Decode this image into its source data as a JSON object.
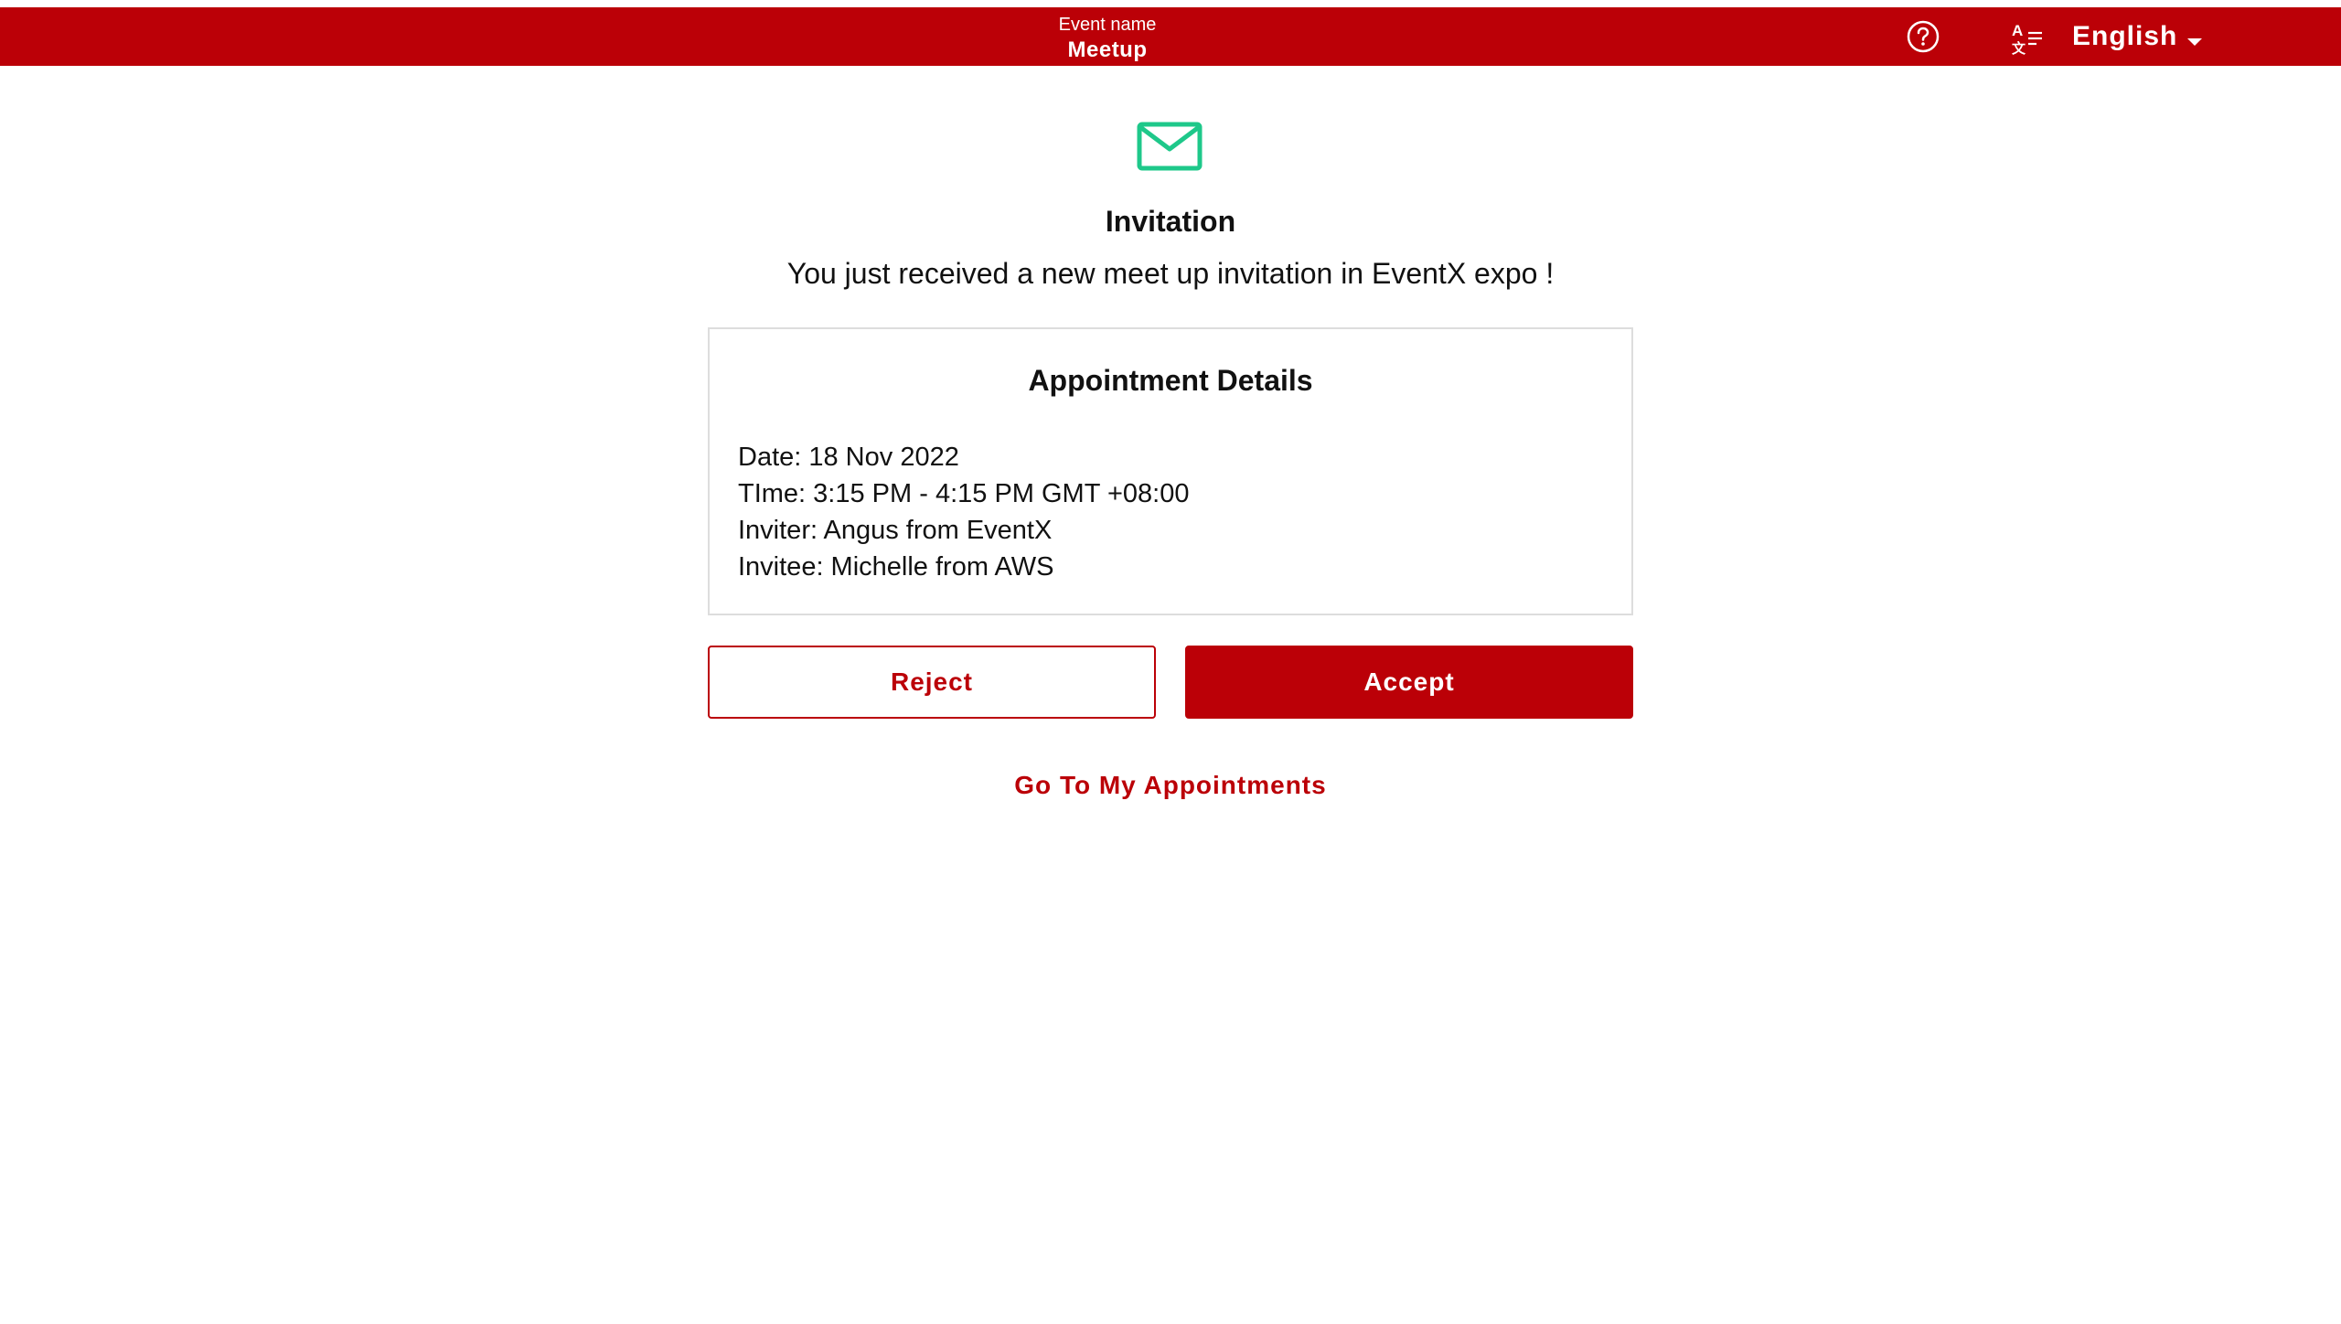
{
  "header": {
    "event_caption": "Event name",
    "event_name": "Meetup",
    "help_icon": "question-circle-icon",
    "language_icon": "translate-icon",
    "language": "English",
    "language_caret_icon": "caret-down-icon"
  },
  "invitation": {
    "icon": "envelope-icon",
    "title": "Invitation",
    "message": "You just received a new meet up invitation in EventX expo !"
  },
  "appointment": {
    "title": "Appointment Details",
    "date": "Date: 18 Nov 2022",
    "time": "TIme: 3:15 PM - 4:15 PM GMT +08:00",
    "inviter": "Inviter: Angus from EventX",
    "invitee": "Invitee: Michelle from AWS"
  },
  "actions": {
    "reject_label": "Reject",
    "accept_label": "Accept",
    "appointments_link": "Go To My Appointments"
  },
  "colors": {
    "brand": "#bb0007",
    "mail_icon": "#1ec88a",
    "card_border": "#dddddd"
  }
}
